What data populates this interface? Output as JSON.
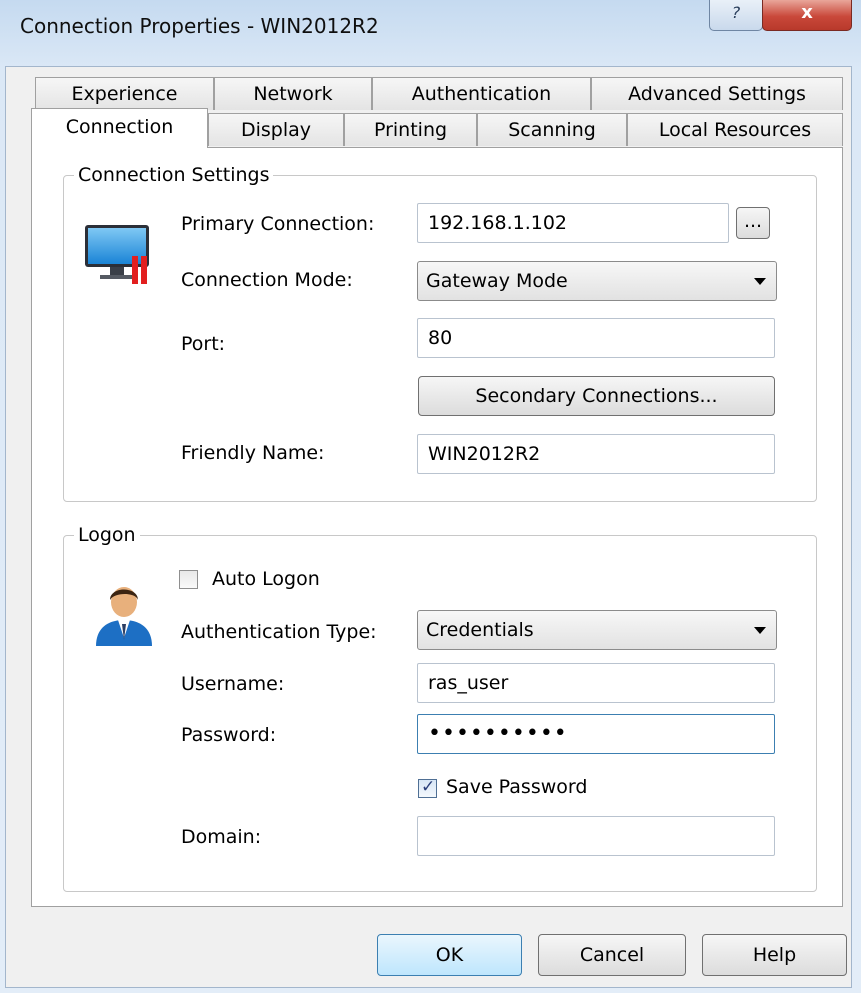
{
  "window": {
    "title": "Connection Properties - WIN2012R2",
    "help_label": "?",
    "close_label": "x"
  },
  "tabs_back": [
    "Experience",
    "Network",
    "Authentication",
    "Advanced Settings"
  ],
  "tabs_front": [
    "Connection",
    "Display",
    "Printing",
    "Scanning",
    "Local Resources"
  ],
  "active_tab": "Connection",
  "connection_settings": {
    "title": "Connection Settings",
    "primary_connection": {
      "label": "Primary Connection:",
      "value": "192.168.1.102",
      "browse_label": "..."
    },
    "connection_mode": {
      "label": "Connection Mode:",
      "value": "Gateway Mode"
    },
    "port": {
      "label": "Port:",
      "value": "80"
    },
    "secondary_button": "Secondary Connections...",
    "friendly_name": {
      "label": "Friendly Name:",
      "value": "WIN2012R2"
    }
  },
  "logon": {
    "title": "Logon",
    "auto_logon": {
      "label": "Auto Logon",
      "checked": false
    },
    "authentication_type": {
      "label": "Authentication Type:",
      "value": "Credentials"
    },
    "username": {
      "label": "Username:",
      "value": "ras_user"
    },
    "password": {
      "label": "Password:",
      "value": "••••••••••"
    },
    "save_password": {
      "label": "Save Password",
      "checked": true
    },
    "domain": {
      "label": "Domain:",
      "value": ""
    }
  },
  "buttons": {
    "ok": "OK",
    "cancel": "Cancel",
    "help": "Help"
  },
  "icons": {
    "connection": "monitor-icon",
    "logon": "user-icon",
    "focus_color": "#3c7fb1"
  }
}
